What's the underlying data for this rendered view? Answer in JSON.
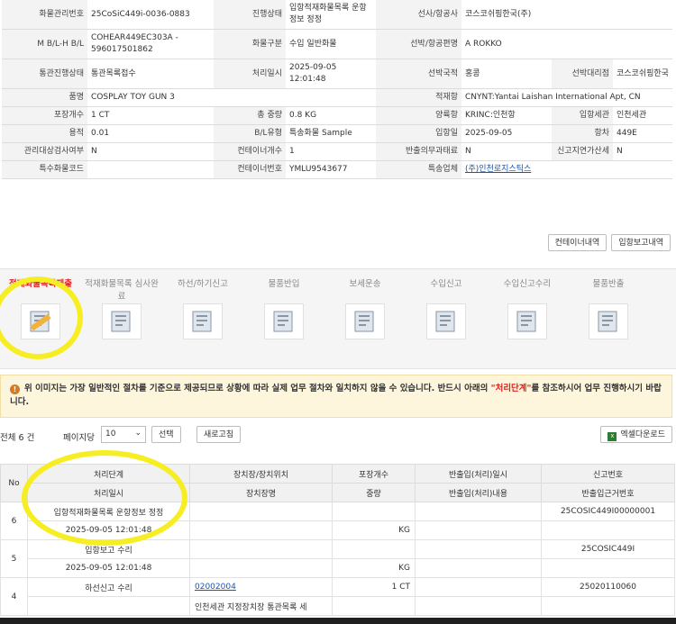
{
  "info": {
    "rows": [
      [
        {
          "l": "화물관리번호",
          "v": "25CoSiC449i-0036-0883"
        },
        {
          "l": "진행상태",
          "v": "입항적재화물목록 운항정보 정정"
        },
        {
          "l": "선사/항공사",
          "v": "코스코쉬핑한국(주)",
          "span": 3
        }
      ],
      [
        {
          "l": "M B/L-H B/L",
          "v": "COHEAR449EC303A - 596017501862"
        },
        {
          "l": "화물구분",
          "v": "수입 일반화물"
        },
        {
          "l": "선박/항공편명",
          "v": "A ROKKO",
          "span": 3
        }
      ],
      [
        {
          "l": "통관진행상태",
          "v": "통관목록접수"
        },
        {
          "l": "처리일시",
          "v": "2025-09-05 12:01:48"
        },
        {
          "l": "선박국적",
          "v": "홍콩"
        },
        {
          "l": "선박대리점",
          "v": "코스코쉬핑한국"
        }
      ],
      [
        {
          "l": "품명",
          "v": "COSPLAY TOY GUN 3",
          "span": 3
        },
        {
          "l": "적재항",
          "v": "CNYNT:Yantai Laishan International Apt, CN",
          "span": 3
        }
      ],
      [
        {
          "l": "포장개수",
          "v": "1 CT"
        },
        {
          "l": "총 중량",
          "v": "0.8 KG"
        },
        {
          "l": "양륙항",
          "v": "KRINC:인천항"
        },
        {
          "l": "입항세관",
          "v": "인천세관"
        }
      ],
      [
        {
          "l": "용적",
          "v": "0.01"
        },
        {
          "l": "B/L유형",
          "v": "특송화물 Sample"
        },
        {
          "l": "입항일",
          "v": "2025-09-05"
        },
        {
          "l": "항차",
          "v": "449E"
        }
      ],
      [
        {
          "l": "관리대상검사여부",
          "v": "N"
        },
        {
          "l": "컨테이너개수",
          "v": "1"
        },
        {
          "l": "반출의무과태료",
          "v": "N"
        },
        {
          "l": "신고지연가산세",
          "v": "N"
        }
      ],
      [
        {
          "l": "특수화물코드",
          "v": ""
        },
        {
          "l": "컨테이너번호",
          "v": "YMLU9543677"
        },
        {
          "l": "특송업체",
          "v": "(주)인천로지스틱스",
          "link": true,
          "span": 3
        }
      ]
    ]
  },
  "buttons": {
    "container_list": "컨테이너내역",
    "arrival_report_list": "입항보고내역"
  },
  "steps": [
    {
      "label": "적재화물목록제출",
      "active": true,
      "icon": "document-icon"
    },
    {
      "label": "적재화물목록 심사완료",
      "active": false,
      "icon": "stamp-icon"
    },
    {
      "label": "하선/하기신고",
      "active": false,
      "icon": "paper-icon"
    },
    {
      "label": "물품반입",
      "active": false,
      "icon": "box-icon"
    },
    {
      "label": "보세운송",
      "active": false,
      "icon": "truck-icon"
    },
    {
      "label": "수입신고",
      "active": false,
      "icon": "clipboard-icon"
    },
    {
      "label": "수입신고수리",
      "active": false,
      "icon": "approve-icon"
    },
    {
      "label": "물품반출",
      "active": false,
      "icon": "release-icon"
    }
  ],
  "notice": {
    "before": "위 이미지는 가장 일반적인 절차를 기준으로 제공되므로 상황에 따라 실제 업무 절차와 일치하지 않을 수 있습니다. 반드시 아래의 ",
    "em": "\"처리단계\"",
    "after": "를 참조하시어 업무 진행하시기 바랍니다."
  },
  "list": {
    "total": "전체 6 건",
    "perpage_label": "페이지당",
    "perpage_value": "10",
    "select_btn": "선택",
    "refresh_btn": "새로고침",
    "excel_btn": "엑셀다운로드"
  },
  "result": {
    "headers_top": [
      "No",
      "처리단계",
      "장치장/장치위치",
      "포장개수",
      "반출입(처리)일시",
      "신고번호"
    ],
    "headers_bottom": [
      "처리일시",
      "장치장명",
      "중량",
      "반출입(처리)내용",
      "반출입근거번호"
    ],
    "rows": [
      {
        "no": "6",
        "stage": "입항적재화물목록 운항정보 정정",
        "date": "2025-09-05 12:01:48",
        "loc": "",
        "loc_name": "",
        "pkg": "",
        "weight": "KG",
        "io_date": "",
        "io_content": "",
        "report_no": "25COSIC449I00000001",
        "basis_no": ""
      },
      {
        "no": "5",
        "stage": "입항보고 수리",
        "date": "2025-09-05 12:01:48",
        "loc": "",
        "loc_name": "",
        "pkg": "",
        "weight": "KG",
        "io_date": "",
        "io_content": "",
        "report_no": "25COSIC449I",
        "basis_no": ""
      },
      {
        "no": "4",
        "stage": "하선신고 수리",
        "date": "",
        "loc": "02002004",
        "loc_name": "인천세관 지정장치장 통관목록 세",
        "pkg": "1 CT",
        "weight": "",
        "io_date": "",
        "io_content": "",
        "report_no": "25020110060",
        "basis_no": ""
      }
    ]
  }
}
